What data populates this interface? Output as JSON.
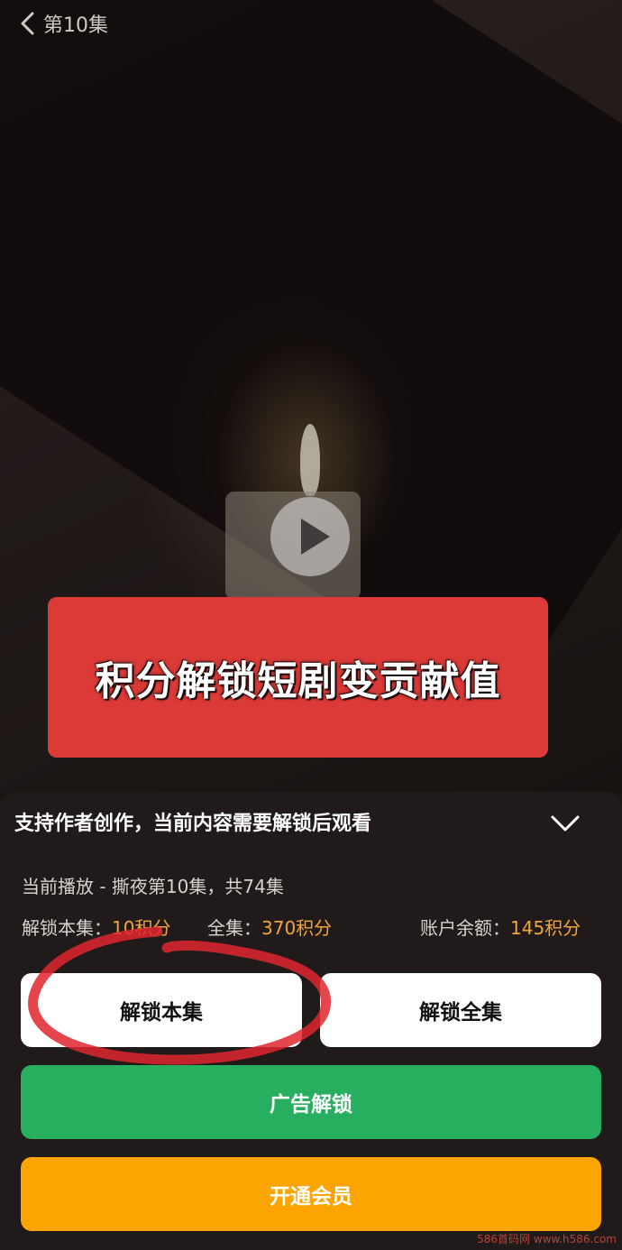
{
  "header": {
    "episode_title": "第10集"
  },
  "banner": {
    "text": "积分解锁短剧变贡献值"
  },
  "unlock_sheet": {
    "title": "支持作者创作，当前内容需要解锁后观看",
    "now_playing": "当前播放 - 撕夜第10集，共74集",
    "episode_price_label": "解锁本集：",
    "episode_price_value": "10积分",
    "all_price_label": "全集：",
    "all_price_value": "370积分",
    "balance_label": "账户余额：",
    "balance_value": "145积分",
    "buttons": {
      "unlock_episode": "解锁本集",
      "unlock_all": "解锁全集",
      "ad_unlock": "广告解锁",
      "vip": "开通会员"
    }
  },
  "watermark": "586首码网 www.h586.com",
  "colors": {
    "price_accent": "#f0a53a",
    "banner_red": "#dc3a37",
    "ad_green": "#27ae5f",
    "vip_orange": "#fca502"
  },
  "icons": [
    "back-chevron-icon",
    "play-icon",
    "chevron-down-icon"
  ]
}
